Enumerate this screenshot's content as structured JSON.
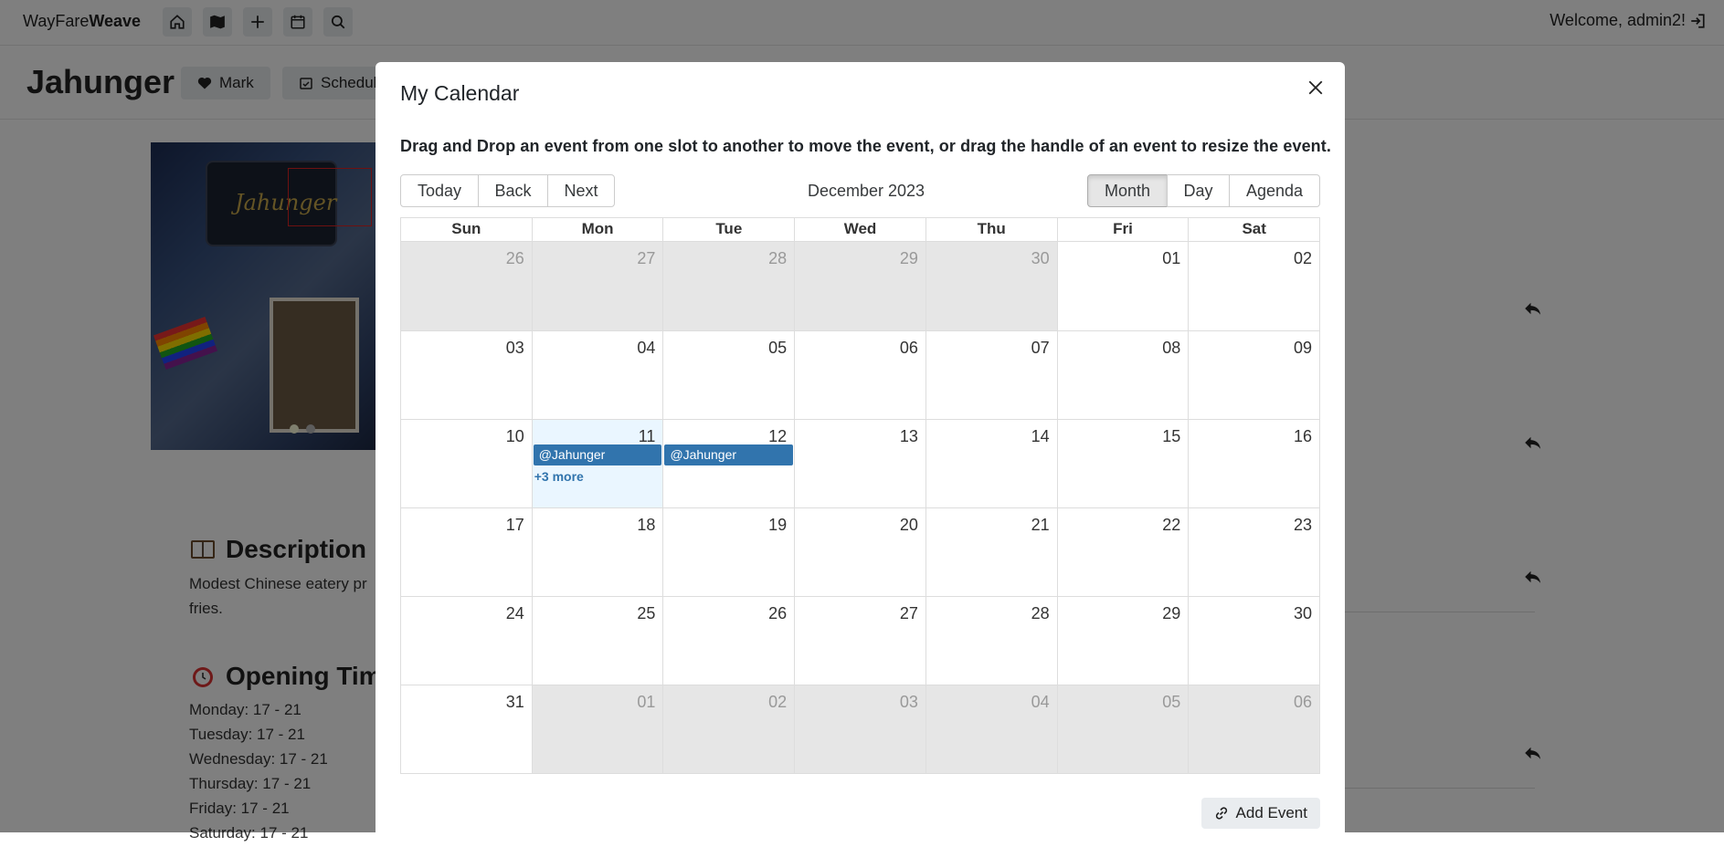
{
  "navbar": {
    "brand_light": "WayFare",
    "brand_bold": "Weave",
    "welcome": "Welcome, admin2!"
  },
  "place": {
    "title": "Jahunger",
    "mark_label": "Mark",
    "schedule_label": "Schedule",
    "photo_sign": "Jahunger",
    "description_heading": "Description",
    "description_text": "Modest Chinese eatery pr fries.",
    "opening_heading": "Opening Tim",
    "hours": [
      "Monday: 17 - 21",
      "Tuesday: 17 - 21",
      "Wednesday: 17 - 21",
      "Thursday: 17 - 21",
      "Friday: 17 - 21",
      "Saturday: 17 - 21"
    ]
  },
  "modal": {
    "title": "My Calendar",
    "instructions": "Drag and Drop an event from one slot to another to move the event, or drag the handle of an event to resize the event.",
    "nav_buttons": [
      "Today",
      "Back",
      "Next"
    ],
    "month_label": "December 2023",
    "view_buttons": [
      "Month",
      "Day",
      "Agenda"
    ],
    "active_view": "Month",
    "weekdays": [
      "Sun",
      "Mon",
      "Tue",
      "Wed",
      "Thu",
      "Fri",
      "Sat"
    ],
    "weeks": [
      [
        "26",
        "27",
        "28",
        "29",
        "30",
        "01",
        "02"
      ],
      [
        "03",
        "04",
        "05",
        "06",
        "07",
        "08",
        "09"
      ],
      [
        "10",
        "11",
        "12",
        "13",
        "14",
        "15",
        "16"
      ],
      [
        "17",
        "18",
        "19",
        "20",
        "21",
        "22",
        "23"
      ],
      [
        "24",
        "25",
        "26",
        "27",
        "28",
        "29",
        "30"
      ],
      [
        "31",
        "01",
        "02",
        "03",
        "04",
        "05",
        "06"
      ]
    ],
    "off_range": [
      [
        true,
        true,
        true,
        true,
        true,
        false,
        false
      ],
      [
        false,
        false,
        false,
        false,
        false,
        false,
        false
      ],
      [
        false,
        false,
        false,
        false,
        false,
        false,
        false
      ],
      [
        false,
        false,
        false,
        false,
        false,
        false,
        false
      ],
      [
        false,
        false,
        false,
        false,
        false,
        false,
        false
      ],
      [
        false,
        true,
        true,
        true,
        true,
        true,
        true
      ]
    ],
    "today": {
      "week": 2,
      "day": 1
    },
    "events": [
      {
        "week": 2,
        "day": 1,
        "label": "@Jahunger"
      },
      {
        "week": 2,
        "day": 2,
        "label": "@Jahunger"
      }
    ],
    "more_link": {
      "week": 2,
      "day": 1,
      "label": "+3 more"
    },
    "add_event_label": "Add Event"
  }
}
